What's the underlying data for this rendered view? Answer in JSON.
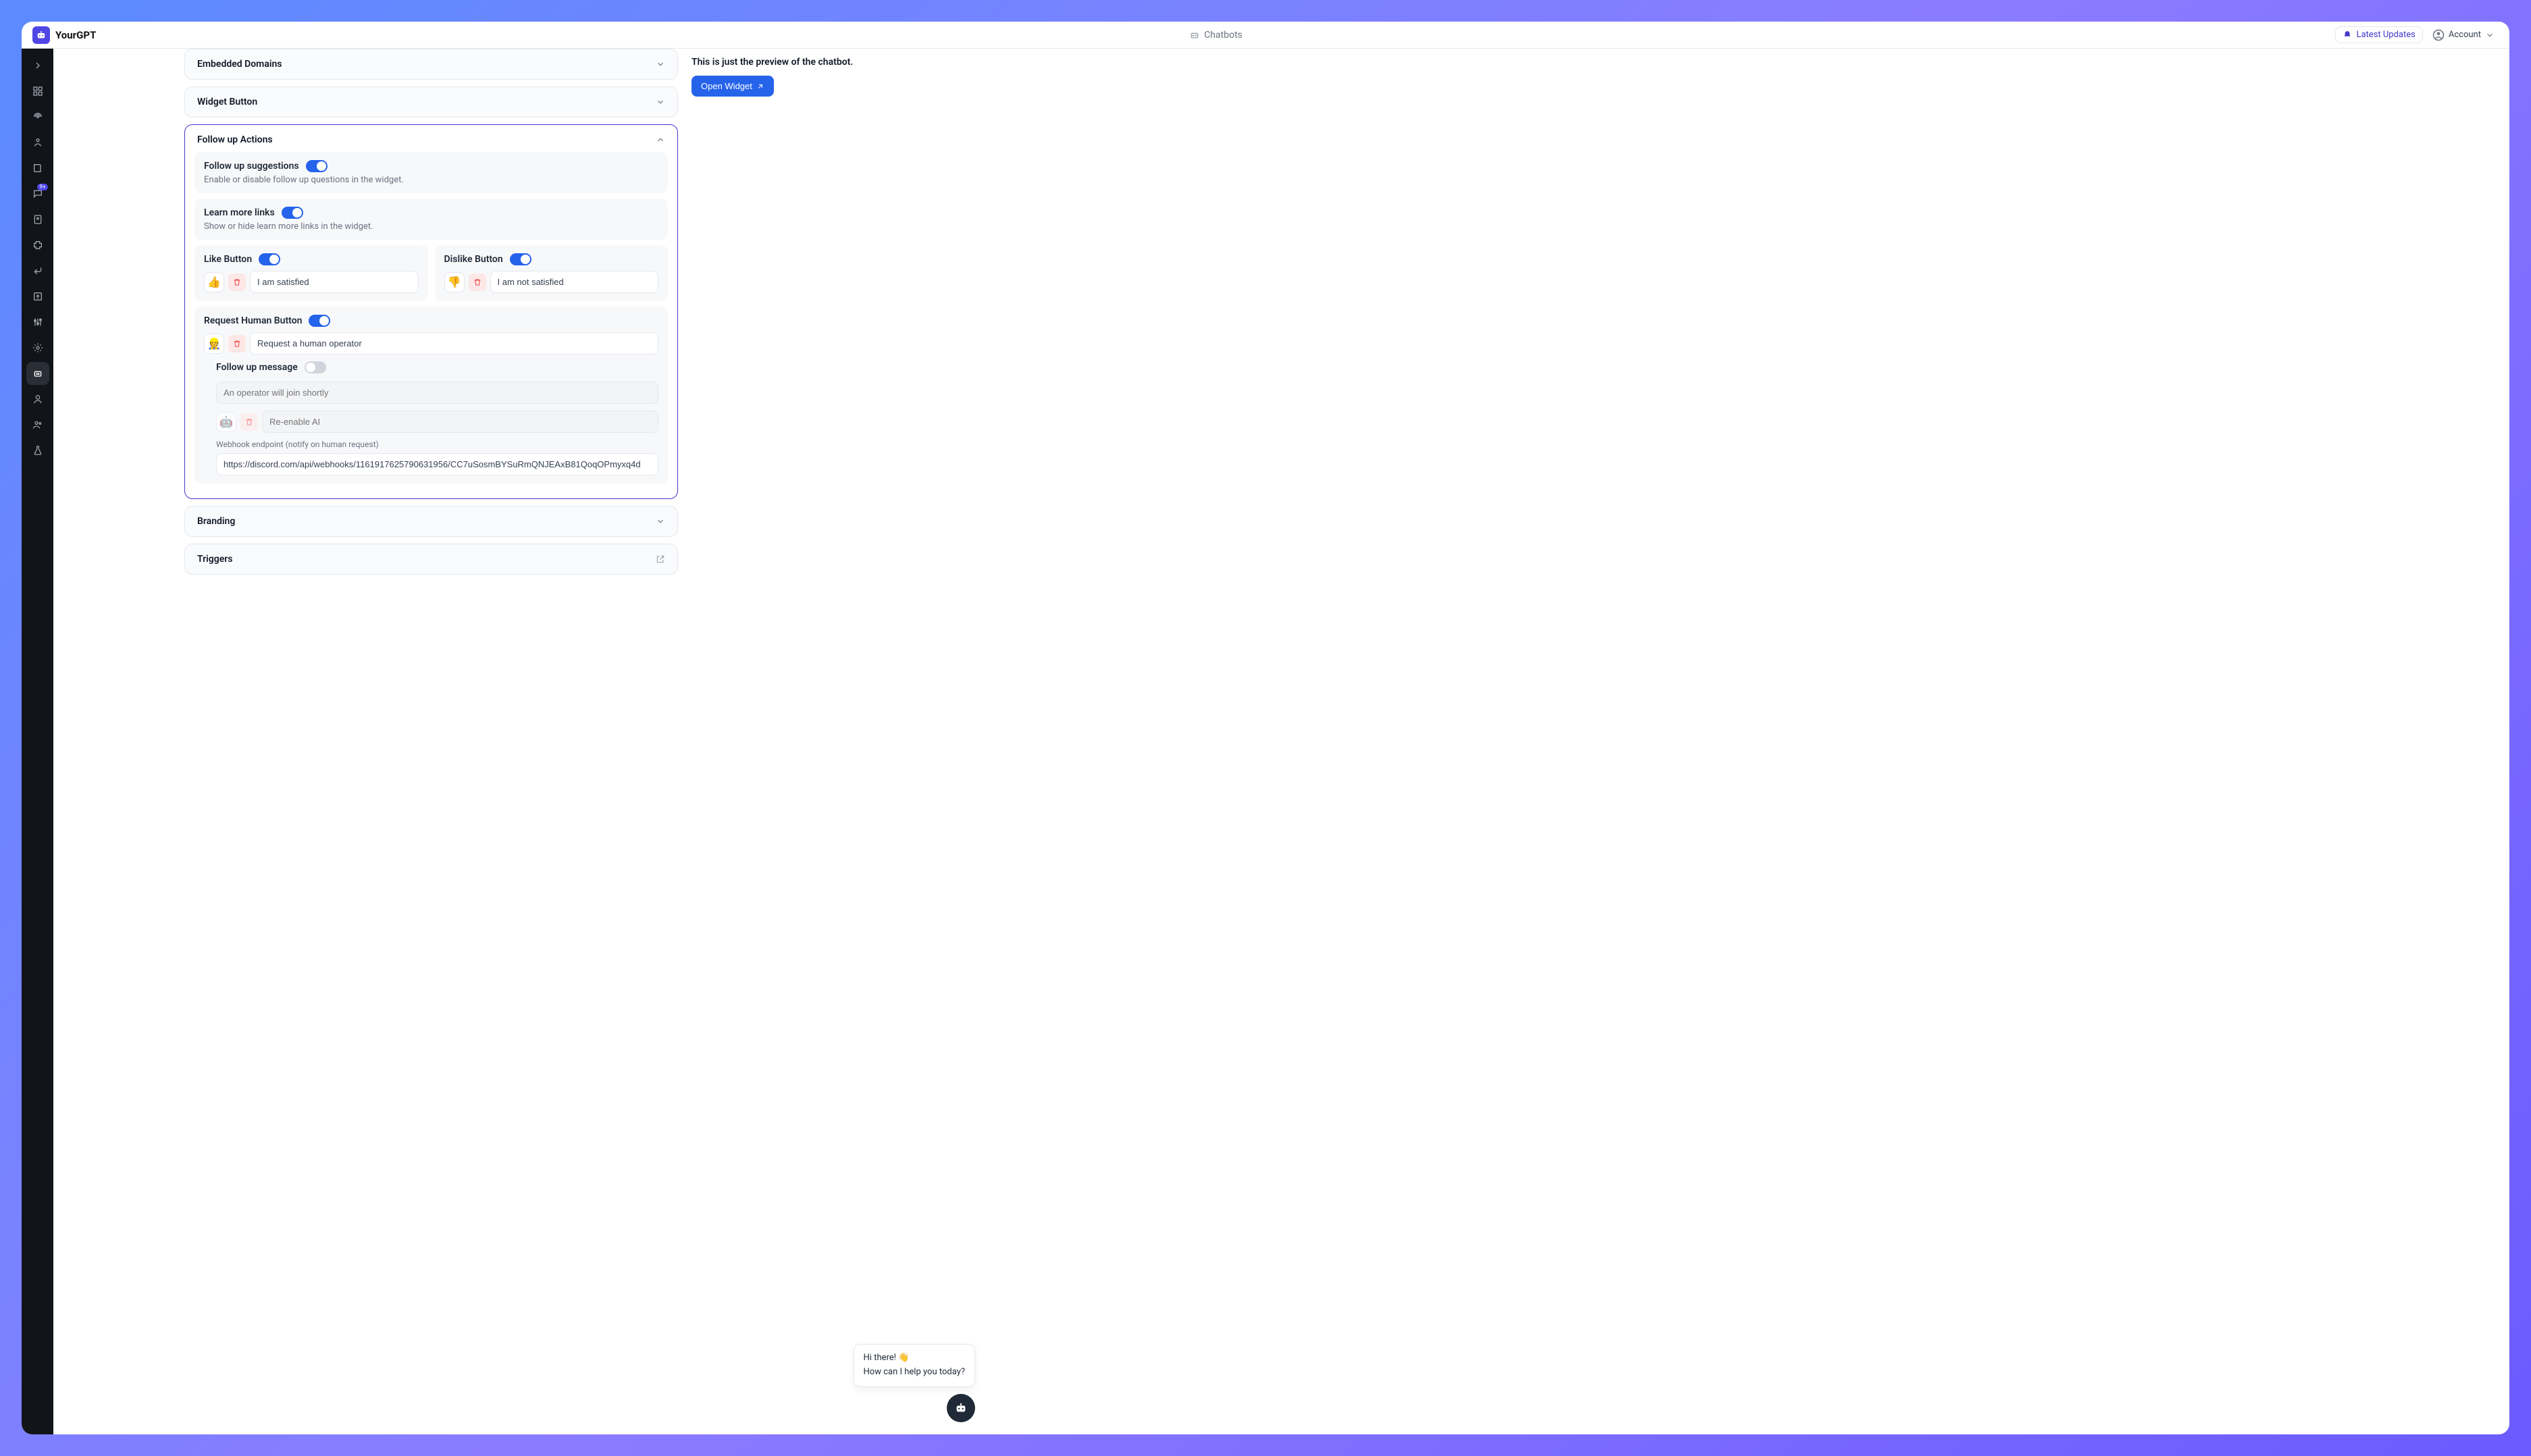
{
  "header": {
    "brand": "YourGPT",
    "center_label": "Chatbots",
    "latest_updates": "Latest Updates",
    "account": "Account"
  },
  "sidebar": {
    "items": [
      "expand",
      "dashboard",
      "signal",
      "bot",
      "book",
      "chat",
      "contact",
      "puzzle",
      "reply",
      "export",
      "tune",
      "settings",
      "widget",
      "user",
      "users",
      "flask"
    ],
    "chat_badge": "9+"
  },
  "sections": {
    "embedded_domains": "Embedded Domains",
    "widget_button": "Widget Button",
    "follow_up_actions": {
      "title": "Follow up Actions",
      "follow_up_suggestions": {
        "title": "Follow up suggestions",
        "desc": "Enable or disable follow up questions in the widget."
      },
      "learn_more_links": {
        "title": "Learn more links",
        "desc": "Show or hide learn more links in the widget."
      },
      "like_button": {
        "title": "Like Button",
        "emoji": "👍",
        "value": "I am satisfied"
      },
      "dislike_button": {
        "title": "Dislike Button",
        "emoji": "👎",
        "value": "I am not satisfied"
      },
      "request_human": {
        "title": "Request Human Button",
        "emoji": "👷",
        "value": "Request a human operator",
        "follow_up_message_title": "Follow up message",
        "follow_up_placeholder": "An operator will join shortly",
        "reenable_emoji": "🤖",
        "reenable_placeholder": "Re-enable AI",
        "webhook_label": "Webhook endpoint (notify on human request)",
        "webhook_value": "https://discord.com/api/webhooks/1161917625790631956/CC7uSosmBYSuRmQNJEAxB81QoqOPmyxq4d"
      }
    },
    "branding": "Branding",
    "triggers": "Triggers"
  },
  "preview": {
    "notice": "This is just the preview of the chatbot.",
    "open_widget": "Open Widget",
    "chat_line1": "Hi there! 👋",
    "chat_line2": "How can I help you today?"
  }
}
